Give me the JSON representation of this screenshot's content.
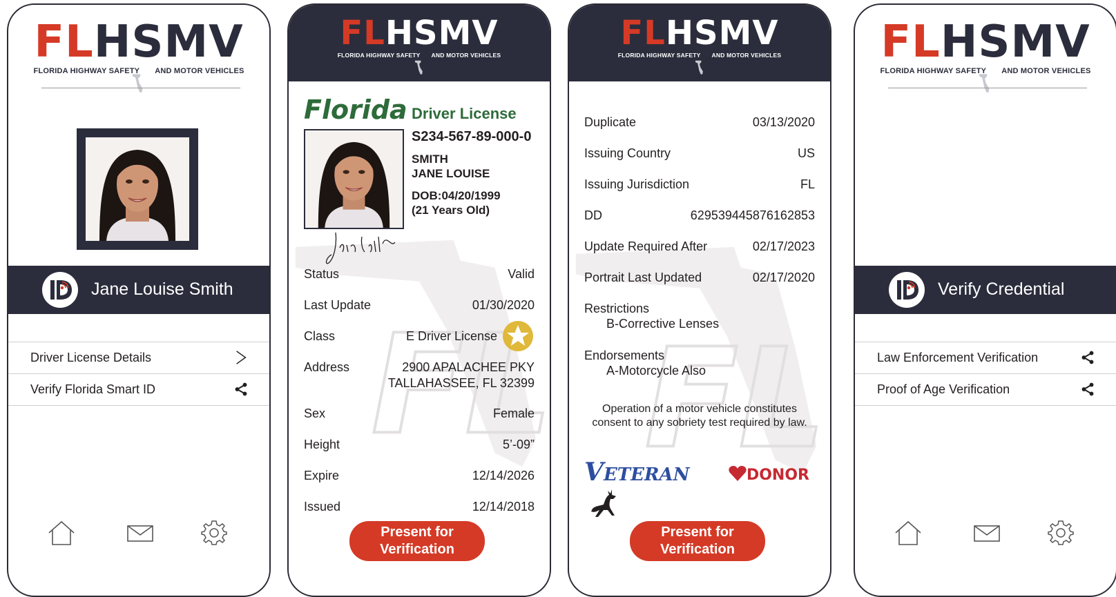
{
  "logo": {
    "fl": "FL",
    "rest": "HSMV",
    "sub_left": "FLORIDA HIGHWAY SAFETY",
    "sub_right": "AND MOTOR VEHICLES"
  },
  "screen1": {
    "name": "Jane Louise Smith",
    "menu": [
      {
        "label": "Driver License Details",
        "icon": "chevron-right-icon"
      },
      {
        "label": "Verify Florida Smart ID",
        "icon": "share-icon"
      }
    ],
    "nav": [
      "home-icon",
      "mail-icon",
      "gear-icon"
    ]
  },
  "screen2": {
    "state": "Florida",
    "doc_type": "Driver License",
    "license_number": "S234-567-89-000-0",
    "surname": "SMITH",
    "given_names": "JANE LOUISE",
    "dob": "DOB:04/20/1999",
    "age": "(21 Years Old)",
    "fields": [
      {
        "key": "Status",
        "value": "Valid"
      },
      {
        "key": "Last Update",
        "value": "01/30/2020"
      },
      {
        "key": "Class",
        "value": "E Driver License"
      },
      {
        "key": "Address",
        "value": "2900 APALACHEE PKY",
        "value2": "TALLAHASSEE, FL 32399"
      },
      {
        "key": "Sex",
        "value": "Female"
      },
      {
        "key": "Height",
        "value": "5’-09”"
      },
      {
        "key": "Expire",
        "value": "12/14/2026"
      },
      {
        "key": "Issued",
        "value": "12/14/2018"
      }
    ],
    "button": {
      "line1": "Present for",
      "line2": "Verification"
    }
  },
  "screen3": {
    "fields": [
      {
        "key": "Duplicate",
        "value": "03/13/2020"
      },
      {
        "key": "Issuing Country",
        "value": "US"
      },
      {
        "key": "Issuing Jurisdiction",
        "value": "FL"
      },
      {
        "key": "DD",
        "value": "629539445876162853"
      },
      {
        "key": "Update Required After",
        "value": "02/17/2023"
      },
      {
        "key": "Portrait Last Updated",
        "value": "02/17/2020"
      }
    ],
    "restrictions_label": "Restrictions",
    "restrictions_value": "B-Corrective Lenses",
    "endorsements_label": "Endorsements",
    "endorsements_value": "A-Motorcycle Also",
    "notice_line1": "Operation of a motor vehicle constitutes",
    "notice_line2": "consent to any sobriety test required by law.",
    "veteran_v": "V",
    "veteran_rest": "ETERAN",
    "donor": "DONOR",
    "button": {
      "line1": "Present for",
      "line2": "Verification"
    }
  },
  "screen4": {
    "title": "Verify Credential",
    "menu": [
      {
        "label": "Law Enforcement Verification",
        "icon": "share-icon"
      },
      {
        "label": "Proof of Age Verification",
        "icon": "share-icon"
      }
    ],
    "nav": [
      "home-icon",
      "mail-icon",
      "gear-icon"
    ]
  },
  "colors": {
    "navy": "#2b2d3c",
    "red": "#d53a26",
    "green": "#2e6b3a",
    "veteran_blue": "#2d4ea0",
    "star_gold": "#e0b83a"
  }
}
